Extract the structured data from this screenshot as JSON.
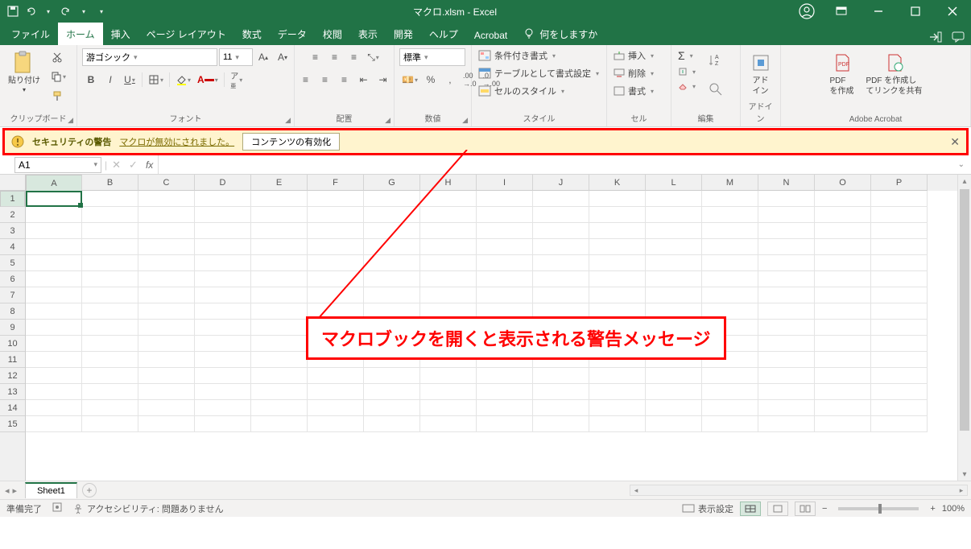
{
  "titlebar": {
    "filename": "マクロ.xlsm",
    "app": "Excel"
  },
  "tabs": {
    "file": "ファイル",
    "home": "ホーム",
    "insert": "挿入",
    "layout": "ページ レイアウト",
    "formulas": "数式",
    "data": "データ",
    "review": "校閲",
    "view": "表示",
    "developer": "開発",
    "help": "ヘルプ",
    "acrobat": "Acrobat",
    "tellme": "何をしますか"
  },
  "ribbon": {
    "clipboard": {
      "paste": "貼り付け",
      "label": "クリップボード"
    },
    "font": {
      "name": "游ゴシック",
      "size": "11",
      "label": "フォント",
      "bold": "B",
      "italic": "I",
      "underline": "U"
    },
    "alignment": {
      "label": "配置"
    },
    "number": {
      "format": "標準",
      "label": "数値"
    },
    "styles": {
      "conditional": "条件付き書式",
      "table": "テーブルとして書式設定",
      "cell": "セルのスタイル",
      "label": "スタイル"
    },
    "cells": {
      "insert": "挿入",
      "delete": "削除",
      "format": "書式",
      "label": "セル"
    },
    "editing": {
      "label": "編集"
    },
    "addin": {
      "btn": "アド\nイン",
      "label": "アドイン"
    },
    "acrobat": {
      "create": "PDF\nを作成",
      "share": "PDF を作成し\nてリンクを共有",
      "label": "Adobe Acrobat"
    }
  },
  "security": {
    "title": "セキュリティの警告",
    "message": "マクロが無効にされました。",
    "enable": "コンテンツの有効化"
  },
  "namebox": "A1",
  "fx": "fx",
  "columns": [
    "A",
    "B",
    "C",
    "D",
    "E",
    "F",
    "G",
    "H",
    "I",
    "J",
    "K",
    "L",
    "M",
    "N",
    "O",
    "P"
  ],
  "rows": [
    "1",
    "2",
    "3",
    "4",
    "5",
    "6",
    "7",
    "8",
    "9",
    "10",
    "11",
    "12",
    "13",
    "14",
    "15"
  ],
  "sheet_tab": "Sheet1",
  "status": {
    "ready": "準備完了",
    "accessibility": "アクセシビリティ: 問題ありません",
    "display_settings": "表示設定",
    "zoom": "100%"
  },
  "annotation": "マクロブックを開くと表示される警告メッセージ"
}
